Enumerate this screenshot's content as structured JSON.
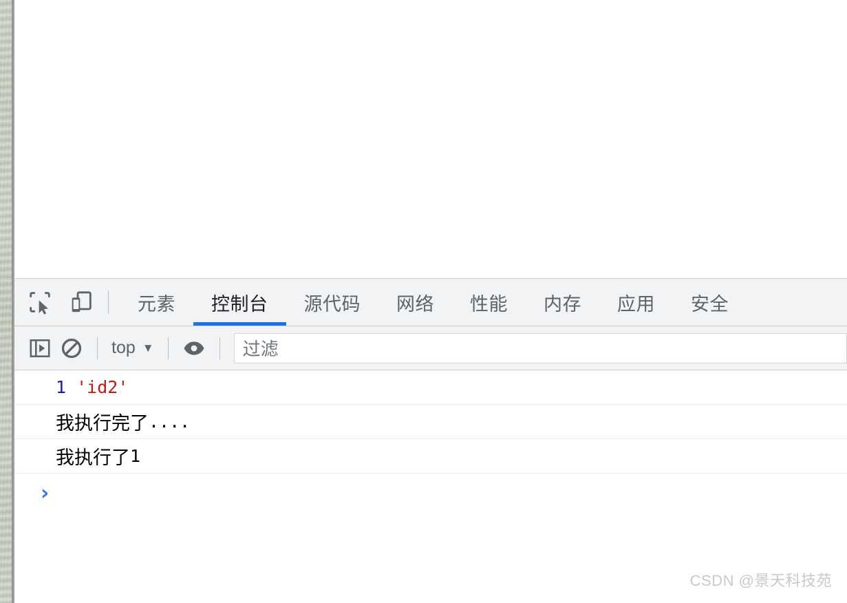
{
  "window": {
    "page_background": "#ffffff",
    "accent_color": "#1a73e8"
  },
  "devtools": {
    "tabbar": {
      "icons": [
        {
          "name": "inspect-element-icon",
          "title": "检查元素"
        },
        {
          "name": "device-toolbar-icon",
          "title": "切换设备工具栏"
        }
      ],
      "tabs": [
        {
          "label": "元素",
          "active": false
        },
        {
          "label": "控制台",
          "active": true
        },
        {
          "label": "源代码",
          "active": false
        },
        {
          "label": "网络",
          "active": false
        },
        {
          "label": "性能",
          "active": false
        },
        {
          "label": "内存",
          "active": false
        },
        {
          "label": "应用",
          "active": false
        },
        {
          "label": "安全",
          "active": false
        }
      ]
    },
    "console_toolbar": {
      "sidebar_icon": "show-console-sidebar-icon",
      "clear_icon": "clear-console-icon",
      "context_value": "top",
      "context_caret": "▼",
      "eye_icon": "live-expression-eye-icon",
      "filter_placeholder": "过滤",
      "filter_value": ""
    },
    "console_messages": [
      {
        "type": "log",
        "tokens": [
          {
            "text": "1",
            "style": "number"
          },
          {
            "text": "'id2'",
            "style": "string"
          }
        ]
      },
      {
        "type": "log",
        "tokens": [
          {
            "text": "我执行完了",
            "style": "plain"
          },
          {
            "text": "....",
            "style": "mono"
          }
        ]
      },
      {
        "type": "log",
        "tokens": [
          {
            "text": "我执行了",
            "style": "plain"
          },
          {
            "text": "1",
            "style": "mono"
          }
        ]
      }
    ],
    "prompt": {
      "caret": "›",
      "value": ""
    }
  },
  "watermark": {
    "text": "CSDN @景天科技苑"
  }
}
